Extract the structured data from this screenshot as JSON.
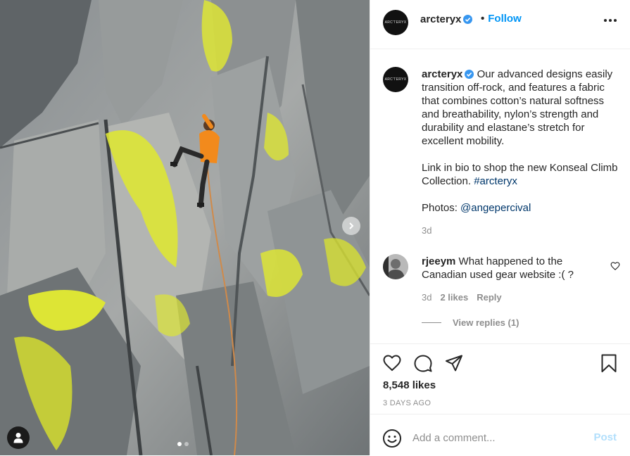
{
  "post": {
    "username": "arcteryx",
    "avatar_text": "ARC'TERYX",
    "follow_separator": "•",
    "follow_label": "Follow",
    "caption": {
      "username": "arcteryx",
      "text": "Our advanced designs easily transition off-rock, and features a fabric that combines cotton’s natural softness and breathability, nylon’s strength and durability and elastane’s stretch for excellent mobility.",
      "line2_text": "Link in bio to shop the new Konseal Climb Collection.",
      "hashtag": "#arcteryx",
      "photos_label": "Photos:",
      "photos_mention": "@angepercival",
      "time": "3d"
    },
    "comment": {
      "username": "rjeeym",
      "text": "What happened to the Canadian used gear website :( ?",
      "time": "3d",
      "likes": "2 likes",
      "reply_label": "Reply",
      "view_replies": "View replies (1)"
    },
    "likes_text": "8,548 likes",
    "posted_time": "3 DAYS AGO",
    "add_comment_placeholder": "Add a comment...",
    "post_label": "Post"
  },
  "carousel": {
    "total": 2,
    "active_index": 0
  },
  "colors": {
    "link_blue": "#0095f6",
    "verified_blue": "#3897f0",
    "post_disabled": "#b2dffc",
    "climber_jacket": "#f28a1c",
    "lichen": "#dde535"
  }
}
